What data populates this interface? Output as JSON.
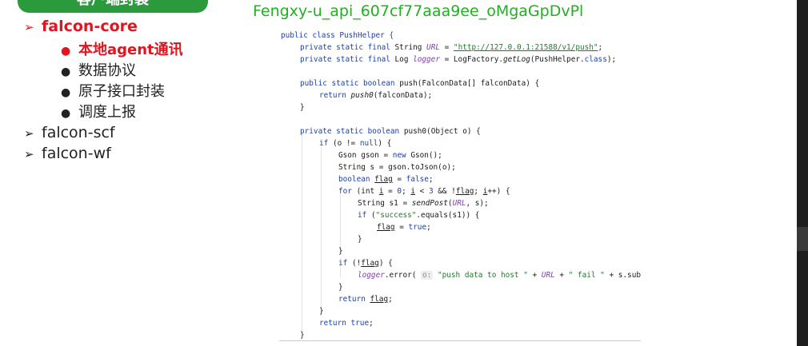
{
  "header": {
    "title": "客户端封装"
  },
  "watermark": "Fengxy-u_api_607cf77aaa9ee_oMgaGpDvPl",
  "outline": {
    "items": [
      {
        "marker": "➢",
        "label": "falcon-core",
        "active": true
      },
      {
        "marker": "➢",
        "label": "falcon-scf",
        "active": false
      },
      {
        "marker": "➢",
        "label": "falcon-wf",
        "active": false
      }
    ],
    "sub_items": [
      {
        "marker": "●",
        "label": "本地agent通讯",
        "active": true
      },
      {
        "marker": "●",
        "label": "数据协议",
        "active": false
      },
      {
        "marker": "●",
        "label": "原子接口封装",
        "active": false
      },
      {
        "marker": "●",
        "label": "调度上报",
        "active": false
      }
    ]
  },
  "code": {
    "t1": "public class PushHelper {",
    "t2a": "private static final ",
    "t2b": "String ",
    "t2c": "URL",
    "t2d": " = ",
    "t2e": "\"http://127.0.0.1:21588/v1/push\"",
    "t2f": ";",
    "t3a": "private static final ",
    "t3b": "Log ",
    "t3c": "logger",
    "t3d": " = LogFactory.",
    "t3e": "getLog",
    "t3f": "(PushHelper.",
    "t3g": "class",
    "t3h": ");",
    "t5a": "public static boolean ",
    "t5b": "push(FalconData[] falconData) {",
    "t6a": "return ",
    "t6b": "push0",
    "t6c": "(falconData);",
    "t7": "}",
    "t9a": "private static boolean ",
    "t9b": "push0(Object o) {",
    "t10a": "if ",
    "t10b": "(o != ",
    "t10c": "null",
    "t10d": ") {",
    "t11a": "Gson gson = ",
    "t11b": "new ",
    "t11c": "Gson();",
    "t12": "String s = gson.toJson(o);",
    "t13a": "boolean ",
    "t13b": "flag",
    "t13c": " = ",
    "t13d": "false",
    "t13e": ";",
    "t14a": "for ",
    "t14b": "(int ",
    "t14c": "i",
    "t14d": " = ",
    "t14e": "0",
    "t14f": "; ",
    "t14g": "i",
    "t14h": " < ",
    "t14i": "3",
    "t14j": " && !",
    "t14k": "flag",
    "t14l": "; ",
    "t14m": "i",
    "t14n": "++) {",
    "t15a": "String s1 = ",
    "t15b": "sendPost",
    "t15c": "(",
    "t15d": "URL",
    "t15e": ", s);",
    "t16a": "if ",
    "t16b": "(",
    "t16c": "\"success\"",
    "t16d": ".equals(s1)) {",
    "t17a": "flag",
    "t17b": " = ",
    "t17c": "true",
    "t17d": ";",
    "t18": "}",
    "t19": "}",
    "t20a": "if ",
    "t20b": "(!",
    "t20c": "flag",
    "t20d": ") {",
    "t21a": "logger",
    "t21b": ".error( ",
    "t21c": "o:",
    "t21d": " \"push data to host \"",
    "t21e": " + ",
    "t21f": "URL",
    "t21g": " + ",
    "t21h": "\" fail \"",
    "t21i": " + s.sub",
    "t22": "}",
    "t23a": "return ",
    "t23b": "flag",
    "t23c": ";",
    "t24": "}",
    "t25a": "return ",
    "t25b": "true",
    "t25c": ";",
    "t26": "}"
  }
}
